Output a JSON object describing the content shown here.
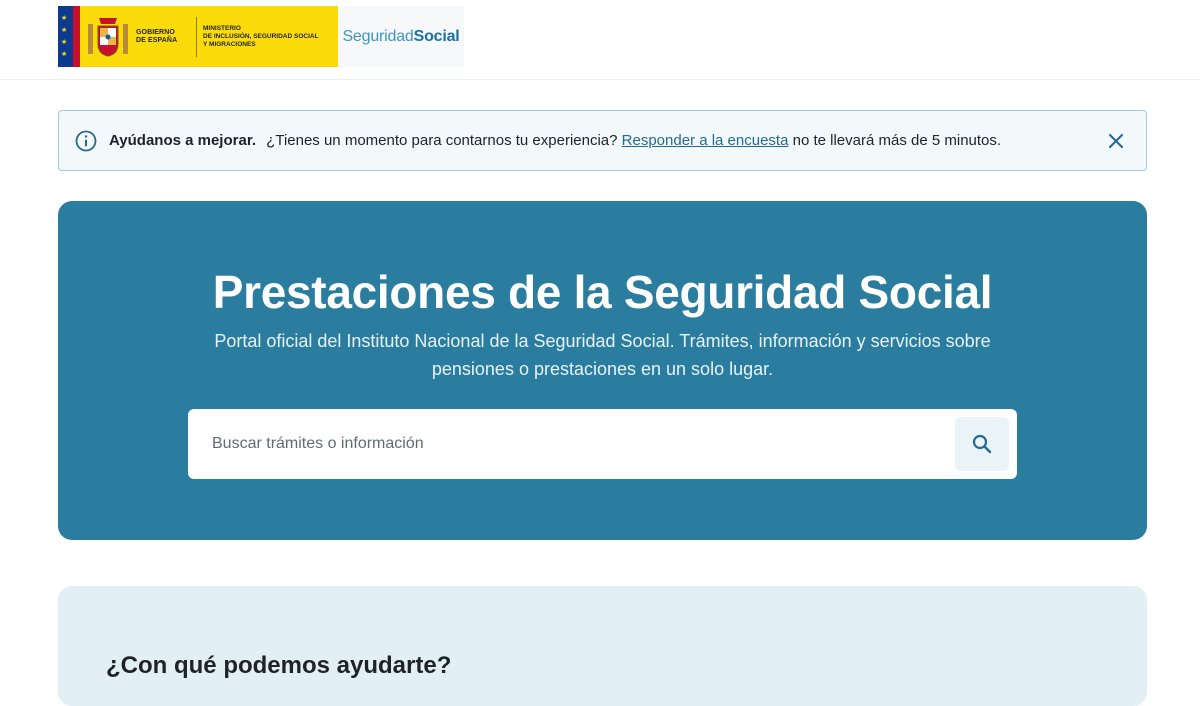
{
  "header": {
    "gov_logo": {
      "gobierno_line1": "GOBIERNO",
      "gobierno_line2": "DE ESPAÑA",
      "ministry_line1": "MINISTERIO",
      "ministry_line2": "DE INCLUSIÓN, SEGURIDAD SOCIAL",
      "ministry_line3": "Y MIGRACIONES",
      "background_color": "#fcdb0a"
    },
    "brand": {
      "part1": "Seguridad",
      "part2": "Social"
    }
  },
  "survey_banner": {
    "icon": "info-icon",
    "strong_text": "Ayúdanos a mejorar.",
    "text_before_link": "¿Tienes un momento para contarnos tu experiencia?",
    "link_text": "Responder a la encuesta",
    "text_after_link": "no te llevará más de 5 minutos.",
    "close_icon": "close-icon"
  },
  "hero": {
    "title": "Prestaciones de la Seguridad Social",
    "subtitle": "Portal oficial del Instituto Nacional de la Seguridad Social. Trámites, información y servicios sobre pensiones o prestaciones en un solo lugar.",
    "search": {
      "placeholder": "Buscar trámites o información",
      "value": "",
      "button_icon": "search-icon"
    },
    "background_color": "#2a7d9e"
  },
  "help_section": {
    "title": "¿Con qué podemos ayudarte?",
    "background_color": "#e2f0f6"
  }
}
